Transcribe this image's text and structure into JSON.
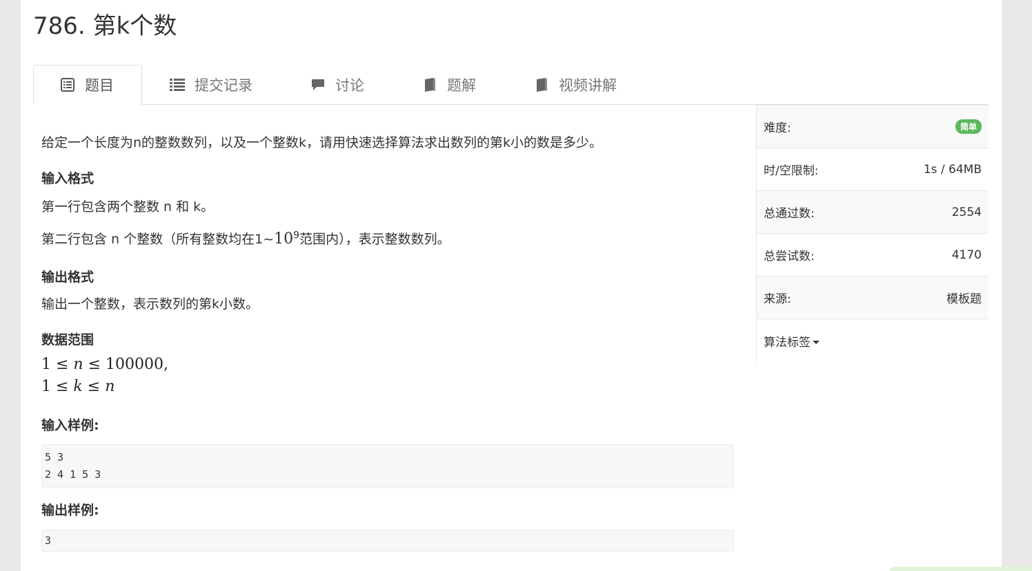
{
  "problem": {
    "title": "786. 第k个数"
  },
  "tabs": [
    {
      "label": "题目",
      "icon": "list-alt-icon",
      "active": true
    },
    {
      "label": "提交记录",
      "icon": "list-icon",
      "active": false
    },
    {
      "label": "讨论",
      "icon": "comment-icon",
      "active": false
    },
    {
      "label": "题解",
      "icon": "book-icon",
      "active": false
    },
    {
      "label": "视频讲解",
      "icon": "book-icon",
      "active": false
    }
  ],
  "content": {
    "description": "给定一个长度为n的整数数列，以及一个整数k，请用快速选择算法求出数列的第k小的数是多少。",
    "input_heading": "输入格式",
    "input_line1": "第一行包含两个整数 n 和 k。",
    "input_line2_prefix": "第二行包含 n 个整数（所有整数均在1~",
    "input_line2_base": "10",
    "input_line2_exp": "9",
    "input_line2_suffix": "范围内），表示整数数列。",
    "output_heading": "输出格式",
    "output_line": "输出一个整数，表示数列的第k小数。",
    "range_heading": "数据范围",
    "range_line1_left": "1 ≤ ",
    "range_line1_var": "n",
    "range_line1_right": " ≤ 100000,",
    "range_line2_left": "1 ≤ ",
    "range_line2_var": "k",
    "range_line2_mid": " ≤ ",
    "range_line2_var2": "n",
    "sample_input_heading": "输入样例:",
    "sample_input": "5 3\n2 4 1 5 3",
    "sample_output_heading": "输出样例:",
    "sample_output": "3"
  },
  "sidebar": {
    "difficulty_label": "难度:",
    "difficulty_value": "简单",
    "limit_label": "时/空限制:",
    "limit_value": "1s / 64MB",
    "passed_label": "总通过数:",
    "passed_value": "2554",
    "attempts_label": "总尝试数:",
    "attempts_value": "4170",
    "source_label": "来源:",
    "source_value": "模板题",
    "tags_label": "算法标签"
  },
  "colors": {
    "badge_green": "#5cb85c",
    "tab_text": "#777777",
    "border": "#dddddd"
  }
}
